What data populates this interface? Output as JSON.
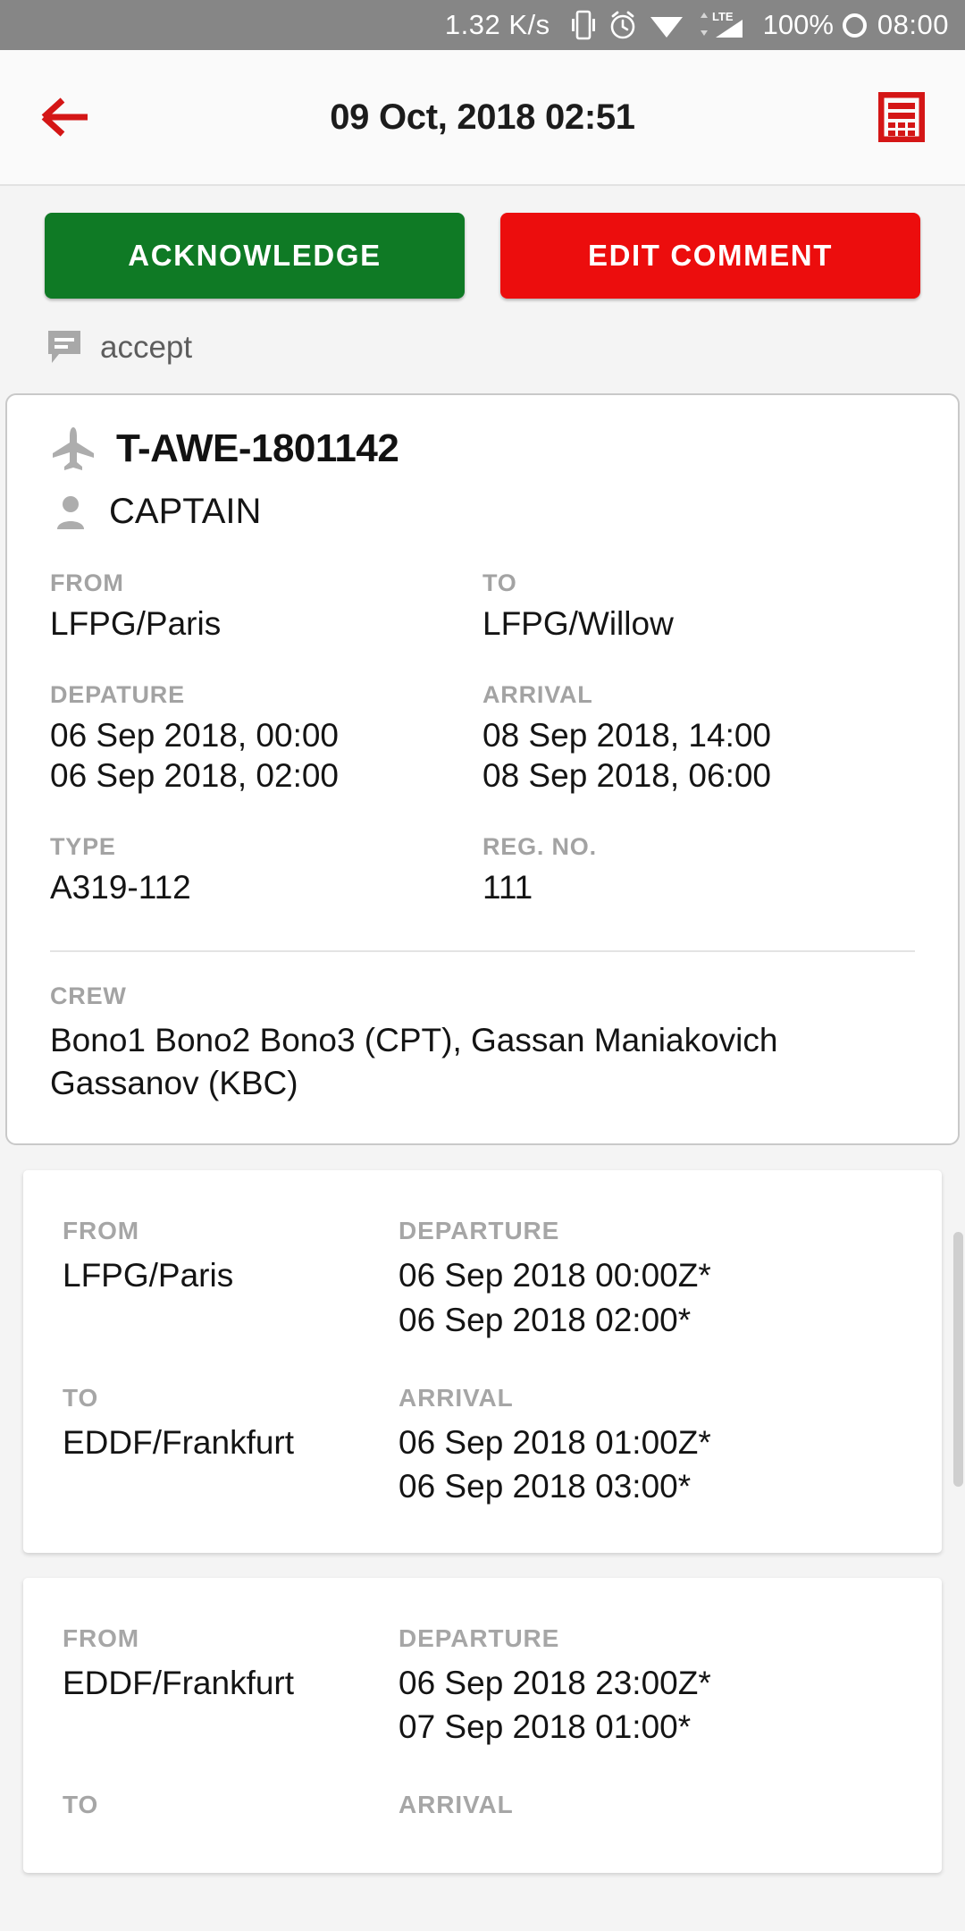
{
  "status_bar": {
    "network_speed": "1.32 K/s",
    "icons": [
      "vibrate-icon",
      "alarm-icon",
      "wifi-icon",
      "lte-signal-icon"
    ],
    "lte_label": "LTE",
    "battery": "100%",
    "clock": "08:00"
  },
  "app_bar": {
    "back_icon": "back-arrow-icon",
    "title": "09 Oct, 2018 02:51",
    "action_icon": "table-report-icon",
    "accent_color": "#d01010"
  },
  "actions": {
    "acknowledge_label": "ACKNOWLEDGE",
    "acknowledge_color": "#0f7a25",
    "edit_comment_label": "EDIT COMMENT",
    "edit_comment_color": "#ec0d0d"
  },
  "comment": {
    "icon": "comment-icon",
    "text": "accept"
  },
  "flight": {
    "plane_icon": "airplane-icon",
    "flight_number": "T-AWE-1801142",
    "person_icon": "person-icon",
    "role": "CAPTAIN",
    "from_label": "FROM",
    "from_value": "LFPG/Paris",
    "to_label": "TO",
    "to_value": "LFPG/Willow",
    "departure_label": "DEPATURE",
    "departure_line1": "06 Sep 2018, 00:00",
    "departure_line2": "06 Sep 2018, 02:00",
    "arrival_label": "ARRIVAL",
    "arrival_line1": "08 Sep 2018, 14:00",
    "arrival_line2": "08 Sep 2018, 06:00",
    "type_label": "TYPE",
    "type_value": "A319-112",
    "reg_label": "REG. NO.",
    "reg_value": "111",
    "crew_label": "CREW",
    "crew_value": "Bono1 Bono2 Bono3 (CPT), Gassan Maniakovich Gassanov (KBC)"
  },
  "legs": [
    {
      "from_label": "FROM",
      "from_value": "LFPG/Paris",
      "departure_label": "DEPARTURE",
      "departure_line1": "06 Sep 2018 00:00Z*",
      "departure_line2": "06 Sep 2018 02:00*",
      "to_label": "TO",
      "to_value": "EDDF/Frankfurt",
      "arrival_label": "ARRIVAL",
      "arrival_line1": "06 Sep 2018 01:00Z*",
      "arrival_line2": "06 Sep 2018 03:00*"
    },
    {
      "from_label": "FROM",
      "from_value": "EDDF/Frankfurt",
      "departure_label": "DEPARTURE",
      "departure_line1": "06 Sep 2018 23:00Z*",
      "departure_line2": "07 Sep 2018 01:00*",
      "to_label": "TO",
      "to_value": "",
      "arrival_label": "ARRIVAL",
      "arrival_line1": "",
      "arrival_line2": ""
    }
  ]
}
